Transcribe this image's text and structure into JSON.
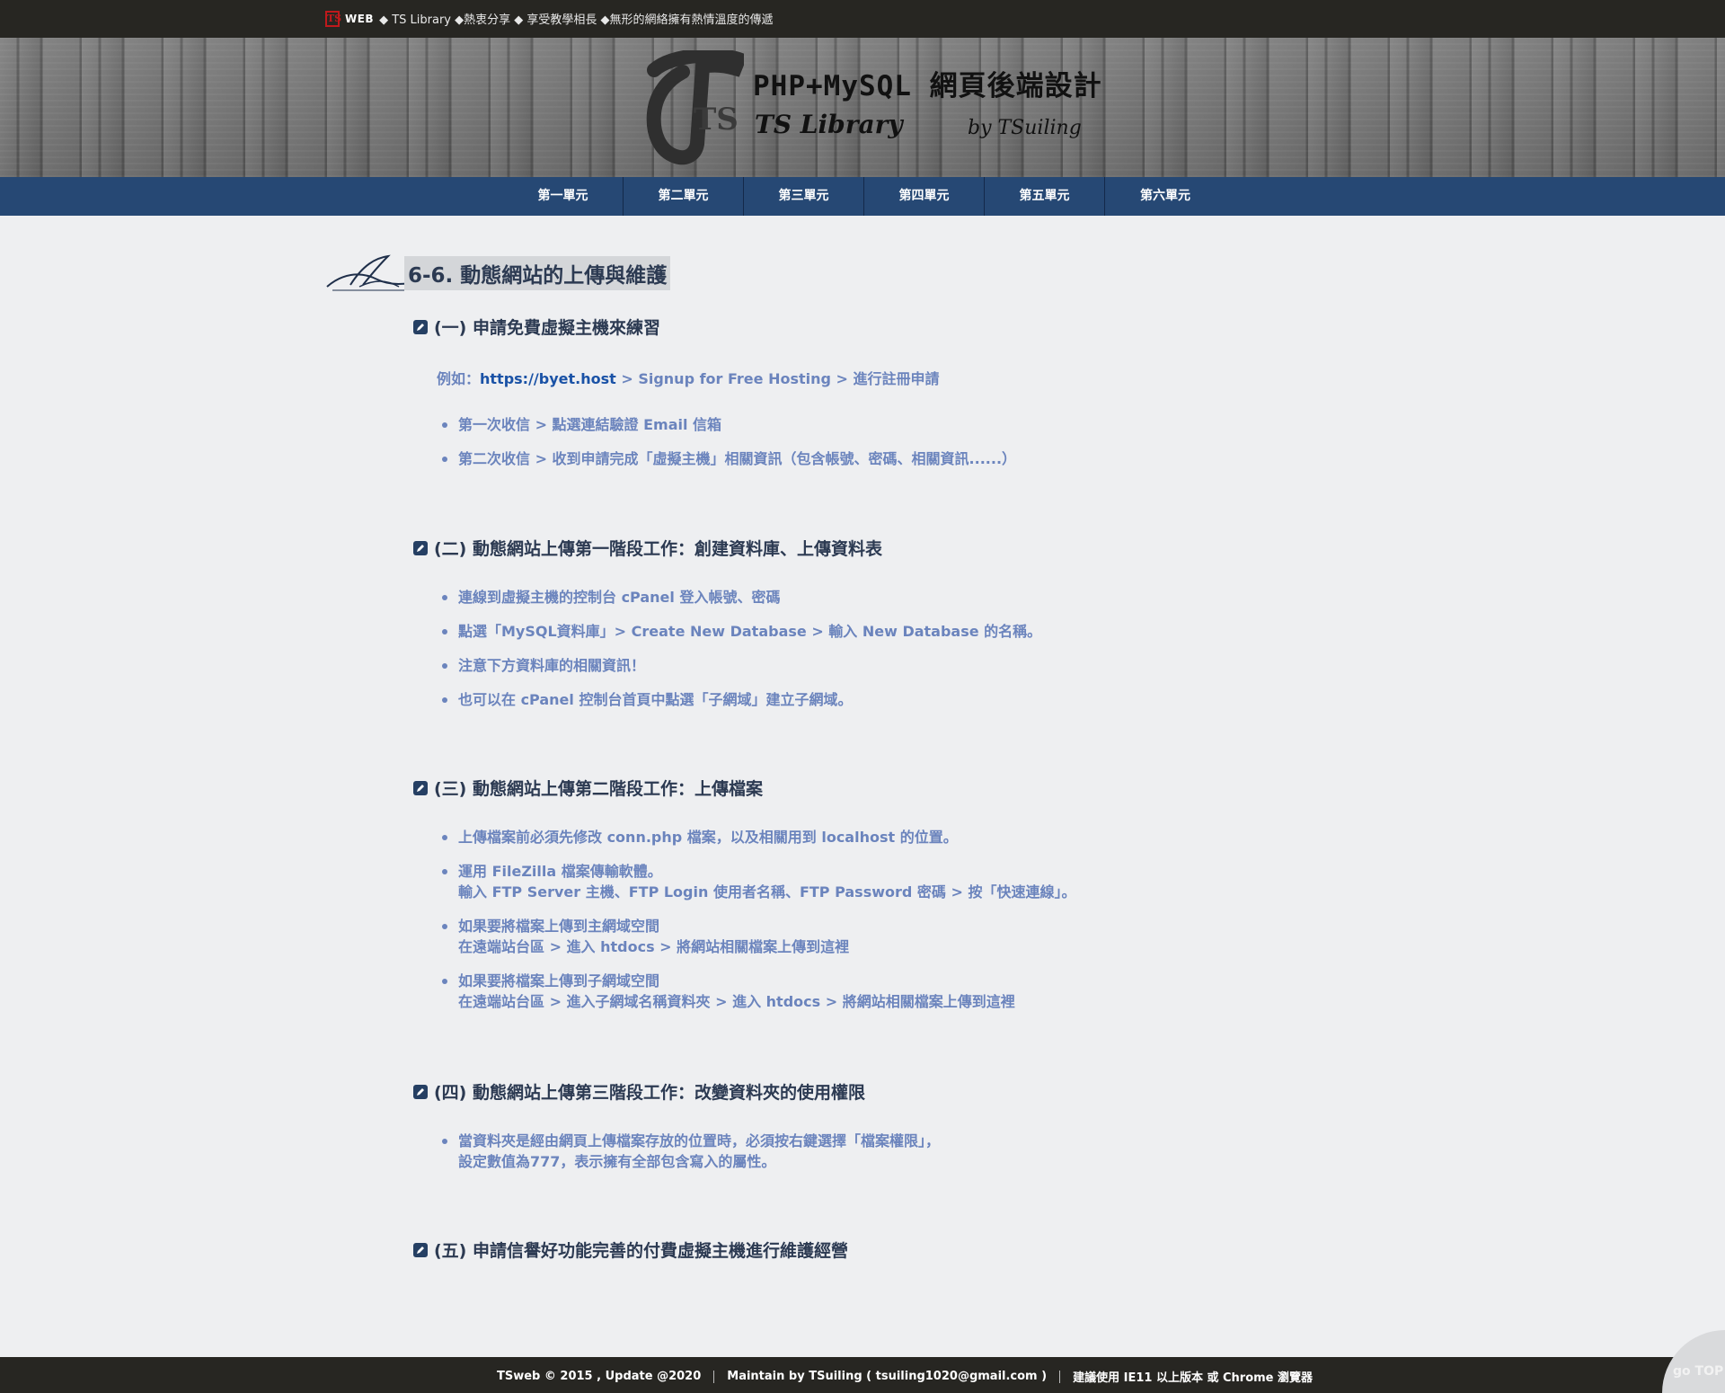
{
  "topbar": {
    "logo": "TS",
    "web": "WEB",
    "tagline": "◆ TS Library ◆熱衷分享 ◆ 享受教學相長 ◆無形的網絡擁有熱情溫度的傳遞"
  },
  "banner": {
    "logo_letters": "TS",
    "title": "PHP+MySQL 網頁後端設計",
    "subtitle": "TS Library",
    "by": "by TSuiling"
  },
  "nav": {
    "items": [
      "第一單元",
      "第二單元",
      "第三單元",
      "第四單元",
      "第五單元",
      "第六單元"
    ]
  },
  "page": {
    "title": "6-6. 動態網站的上傳與維護"
  },
  "sections": [
    {
      "title": "(一) 申請免費虛擬主機來練習",
      "example_prefix": "例如：",
      "example_link": "https://byet.host",
      "example_rest": " > Signup for Free Hosting > 進行註冊申請",
      "items": [
        "第一次收信 > 點選連結驗證 Email 信箱",
        "第二次收信 > 收到申請完成「虛擬主機」相關資訊（包含帳號、密碼、相關資訊......）"
      ]
    },
    {
      "title": "(二) 動態網站上傳第一階段工作：創建資料庫、上傳資料表",
      "items": [
        "連線到虛擬主機的控制台 cPanel 登入帳號、密碼",
        "點選「MySQL資料庫」> Create New Database > 輸入 New Database 的名稱。",
        "注意下方資料庫的相關資訊！",
        "也可以在 cPanel 控制台首頁中點選「子網域」建立子網域。"
      ]
    },
    {
      "title": "(三) 動態網站上傳第二階段工作：上傳檔案",
      "items": [
        [
          "上傳檔案前必須先修改 conn.php 檔案，以及相關用到 localhost 的位置。"
        ],
        [
          "運用 FileZilla 檔案傳輸軟體。",
          "輸入 FTP Server 主機、FTP Login 使用者名稱、FTP Password 密碼 > 按「快速連線」。"
        ],
        [
          "如果要將檔案上傳到主網域空間",
          "在遠端站台區 > 進入 htdocs > 將網站相關檔案上傳到這裡"
        ],
        [
          "如果要將檔案上傳到子網域空間",
          "在遠端站台區 > 進入子網域名稱資料夾 > 進入 htdocs > 將網站相關檔案上傳到這裡"
        ]
      ]
    },
    {
      "title": "(四) 動態網站上傳第三階段工作：改變資料夾的使用權限",
      "items": [
        [
          "當資料夾是經由網頁上傳檔案存放的位置時，必須按右鍵選擇「檔案權限」，",
          "設定數值為777，表示擁有全部包含寫入的屬性。"
        ]
      ]
    },
    {
      "title": "(五) 申請信譽好功能完善的付費虛擬主機進行維護經營",
      "items": []
    }
  ],
  "footer": {
    "copyright": "TSweb © 2015 , Update @2020",
    "maintain": "Maintain by TSuiling ( tsuiling1020@gmail.com )",
    "browser": "建議使用 IE11 以上版本 或 Chrome 瀏覽器"
  },
  "gotop": {
    "label": "go TOP"
  }
}
